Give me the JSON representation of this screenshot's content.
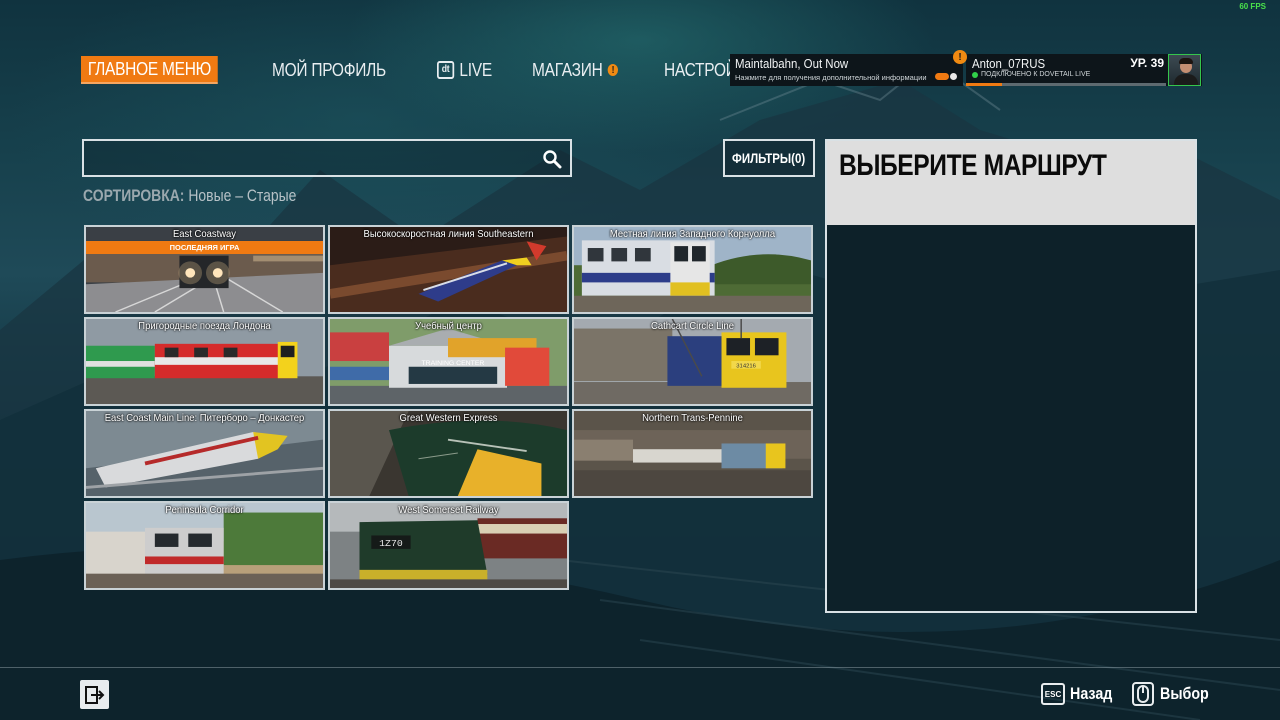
{
  "fps": "60 FPS",
  "nav": {
    "items": [
      {
        "label": "ГЛАВНОЕ МЕНЮ",
        "active": true
      },
      {
        "label": "МОЙ ПРОФИЛЬ"
      },
      {
        "label": "LIVE",
        "icon": "dovetail-live-icon"
      },
      {
        "label": "МАГАЗИН",
        "icon": "alert-icon"
      },
      {
        "label": "НАСТРОЙКИ"
      }
    ]
  },
  "notification": {
    "title": "Maintalbahn, Out Now",
    "subtitle": "Нажмите для получения дополнительной информации",
    "alert": "!"
  },
  "profile": {
    "username": "Anton_07RUS",
    "status": "ПОДКЛЮЧЕНО К DOVETAIL LIVE",
    "level": "УР. 39",
    "xp_progress": 0.18
  },
  "search": {
    "value": "",
    "placeholder": ""
  },
  "filters_label": "ФИЛЬТРЫ(0)",
  "sort": {
    "label": "СОРТИРОВКА:",
    "value": "Новые – Старые"
  },
  "routes": [
    {
      "title": "East Coastway",
      "badge": "ПОСЛЕДНЯЯ ИГРА"
    },
    {
      "title": "Высокоскоростная линия Southeastern"
    },
    {
      "title": "Местная линия Западного Корнуолла"
    },
    {
      "title": "Пригородные поезда Лондона"
    },
    {
      "title": "Учебный центр",
      "sign": "TRAINING CENTER"
    },
    {
      "title": "Cathcart Circle Line",
      "unit": "314216"
    },
    {
      "title": "East Coast Main Line: Питерборо – Донкастер"
    },
    {
      "title": "Great Western Express"
    },
    {
      "title": "Northern Trans-Pennine"
    },
    {
      "title": "Peninsula Corridor"
    },
    {
      "title": "West Somerset Railway",
      "headcode": "1Z70"
    }
  ],
  "details": {
    "title": "ВЫБЕРИТЕ МАРШРУТ"
  },
  "footer": {
    "back_key": "ESC",
    "back_label": "Назад",
    "select_label": "Выбор"
  },
  "colors": {
    "accent": "#f07a12",
    "status_online": "#31d04a",
    "panel_header": "#dedede"
  }
}
